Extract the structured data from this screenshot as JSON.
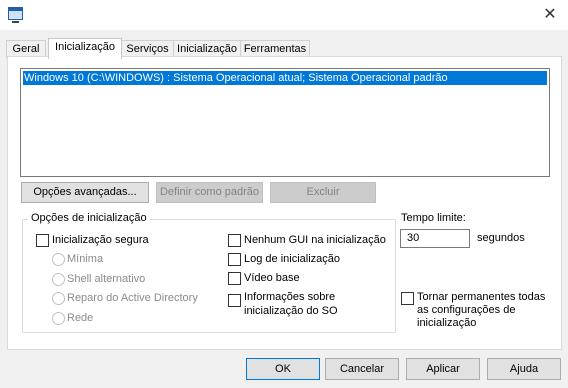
{
  "window": {
    "close_glyph": "✕"
  },
  "tabs": [
    {
      "label": "Geral"
    },
    {
      "label": "Inicialização",
      "active": true
    },
    {
      "label": "Serviços"
    },
    {
      "label": "Inicialização"
    },
    {
      "label": "Ferramentas"
    }
  ],
  "boot_list": {
    "items": [
      "Windows 10 (C:\\WINDOWS) : Sistema Operacional atual; Sistema Operacional padrão"
    ]
  },
  "list_buttons": {
    "advanced": "Opções avançadas...",
    "set_default": "Definir como padrão",
    "delete": "Excluir"
  },
  "boot_options": {
    "title": "Opções de inicialização",
    "safe_boot": "Inicialização segura",
    "minimal": "Mínima",
    "alternate_shell": "Shell alternativo",
    "ad_repair": "Reparo do Active Directory",
    "network": "Rede",
    "no_gui": "Nenhum GUI na inicialização",
    "boot_log": "Log de inicialização",
    "base_video": "Vídeo base",
    "os_info_line1": "Informações sobre",
    "os_info_line2": "inicialização do SO"
  },
  "timeout": {
    "label": "Tempo limite:",
    "value": "30",
    "unit": "segundos"
  },
  "permanent": {
    "line1": "Tornar permanentes todas",
    "line2": "as configurações de",
    "line3": "inicialização"
  },
  "footer_buttons": {
    "ok": "OK",
    "cancel": "Cancelar",
    "apply": "Aplicar",
    "help": "Ajuda"
  },
  "colors": {
    "selection": "#0078d7",
    "panel": "#ffffff",
    "window": "#f0f0f0"
  }
}
